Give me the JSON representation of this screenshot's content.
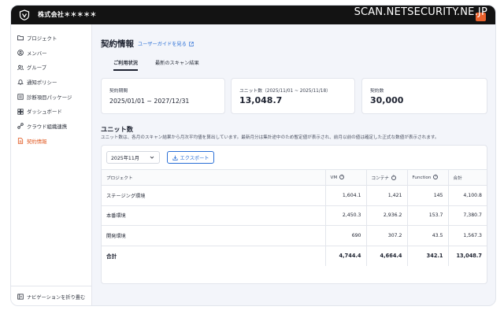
{
  "topbar": {
    "org_name": "株式会社＊＊＊＊＊",
    "watermark": "SCAN.NETSECURITY.NE.JP"
  },
  "sidebar": {
    "items": [
      {
        "label": "プロジェクト",
        "icon": "folder-icon"
      },
      {
        "label": "メンバー",
        "icon": "member-icon"
      },
      {
        "label": "グループ",
        "icon": "group-icon"
      },
      {
        "label": "通知ポリシー",
        "icon": "bell-icon"
      },
      {
        "label": "診断項目パッケージ",
        "icon": "package-icon"
      },
      {
        "label": "ダッシュボード",
        "icon": "dashboard-icon"
      },
      {
        "label": "クラウド組織連携",
        "icon": "cloud-link-icon"
      },
      {
        "label": "契約情報",
        "icon": "contract-icon",
        "active": true
      }
    ],
    "collapse_label": "ナビゲーションを折り畳む"
  },
  "main": {
    "title": "契約情報",
    "guide_link": "ユーザーガイドを見る",
    "tabs": [
      {
        "label": "ご利用状況",
        "active": true
      },
      {
        "label": "最新のスキャン結果",
        "active": false
      }
    ],
    "cards": [
      {
        "label": "契約期間",
        "value": "2025/01/01 ~ 2027/12/31"
      },
      {
        "label": "ユニット数（2025/11/01 ~ 2025/11/18）",
        "value": "13,048.7"
      },
      {
        "label": "契約数",
        "value": "30,000"
      }
    ],
    "section_title": "ユニット数",
    "section_desc": "ユニット数は、各月のスキャン結果から月次平均値を算出しています。最新月分は集計途中のため暫定値が表示され、前月以前の値は確定した正式な数値が表示されます。",
    "month_select": "2025年11月",
    "export_label": "エクスポート",
    "table": {
      "headers": [
        "プロジェクト",
        "VM",
        "コンテナ",
        "Function",
        "合計"
      ],
      "rows": [
        [
          "ステージング環境",
          "1,604.1",
          "1,421",
          "145",
          "4,100.8"
        ],
        [
          "本番環境",
          "2,450.3",
          "2,936.2",
          "153.7",
          "7,380.7"
        ],
        [
          "開発環境",
          "690",
          "307.2",
          "43.5",
          "1,567.3"
        ]
      ],
      "total": [
        "合計",
        "4,744.4",
        "4,664.4",
        "342.1",
        "13,048.7"
      ]
    }
  },
  "colors": {
    "accent": "#e0561e",
    "link": "#2a6fd6",
    "topbar": "#131313"
  }
}
